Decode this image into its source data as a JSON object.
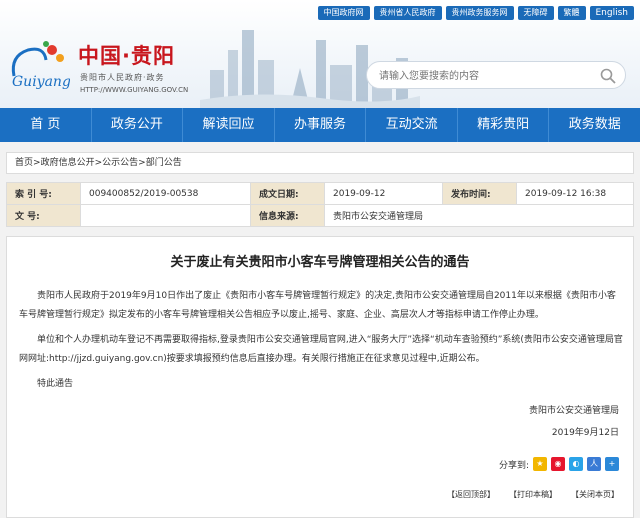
{
  "top_links": [
    "中国政府网",
    "贵州省人民政府",
    "贵州政务服务网",
    "无障碍",
    "繁體",
    "English"
  ],
  "site": {
    "logo_text": "Guiyang",
    "title": "中国·贵阳",
    "subtitle": "贵阳市人民政府·政务",
    "url": "HTTP://WWW.GUIYANG.GOV.CN"
  },
  "search": {
    "placeholder": "请输入您要搜索的内容"
  },
  "nav": [
    "首 页",
    "政务公开",
    "解读回应",
    "办事服务",
    "互动交流",
    "精彩贵阳",
    "政务数据"
  ],
  "breadcrumb": [
    "首页",
    "政府信息公开",
    "公示公告",
    "部门公告"
  ],
  "meta": {
    "index_label": "索 引 号:",
    "index_value": "009400852/2019-00538",
    "date_label": "成文日期:",
    "date_value": "2019-09-12",
    "publish_label": "发布时间:",
    "publish_value": "2019-09-12 16:38",
    "doc_label": "文 号:",
    "doc_value": "",
    "source_label": "信息来源:",
    "source_value": "贵阳市公安交通管理局"
  },
  "article": {
    "title": "关于废止有关贵阳市小客车号牌管理相关公告的通告",
    "p1": "贵阳市人民政府于2019年9月10日作出了废止《贵阳市小客车号牌管理暂行规定》的决定,贵阳市公安交通管理局自2011年以来根据《贵阳市小客车号牌管理暂行规定》拟定发布的小客车号牌管理相关公告相应予以废止,摇号、家庭、企业、高层次人才等指标申请工作停止办理。",
    "p2": "单位和个人办理机动车登记不再需要取得指标,登录贵阳市公安交通管理局官网,进入“服务大厅”选择“机动车查验预约”系统(贵阳市公安交通管理局官网网址:http://jjzd.guiyang.gov.cn)按要求填报预约信息后直接办理。有关限行措施正在征求意见过程中,近期公布。",
    "p3": "特此通告",
    "signature": "贵阳市公安交通管理局",
    "date": "2019年9月12日"
  },
  "share_label": "分享到:",
  "actions": [
    "【返回顶部】",
    "【打印本稿】",
    "【关闭本页】"
  ],
  "colors": {
    "nav_bg": "#1b6fc2",
    "title_red": "#c8161d",
    "meta_label_bg": "#f0e6d0"
  }
}
